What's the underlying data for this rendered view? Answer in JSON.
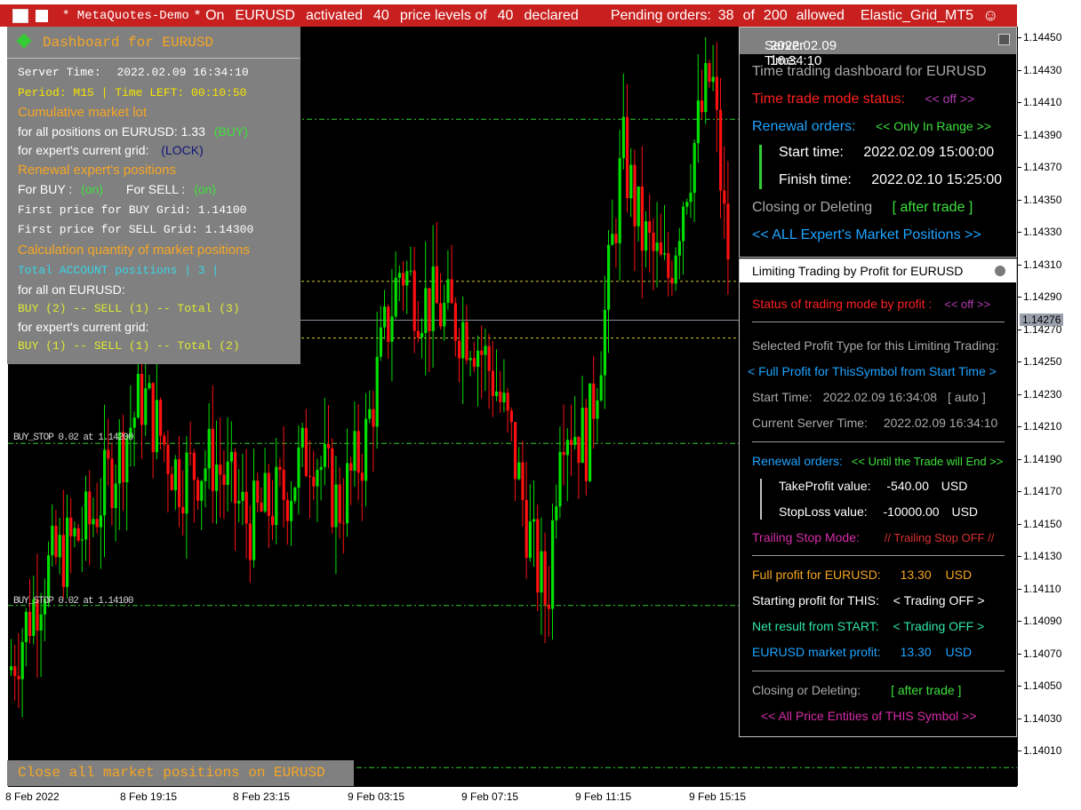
{
  "titlebar": {
    "server_label": "* MetaQuotes-Demo",
    "star": "*",
    "word_on": "On",
    "symbol": "EURUSD",
    "word_activated": "activated",
    "activated_count": "40",
    "word_price_levels_of": "price levels of",
    "declared_count": "40",
    "word_declared": "declared",
    "pending_label": "Pending orders:",
    "pending_count": "38",
    "word_of": "of",
    "pending_max": "200",
    "word_allowed": "allowed",
    "expert_name": "Elastic_Grid_MT5",
    "smiley": "☺"
  },
  "left_panel": {
    "title": "Dashboard for EURUSD",
    "server_time_label": "Server Time:",
    "server_time_value": "2022.02.09 16:34:10",
    "period_line": "Period: M15 | Time LEFT: 00:10:50",
    "cumulative_heading": "Cumulative market lot",
    "all_positions_label": "for all positions on EURUSD: 1.33",
    "all_positions_dir": "(BUY)",
    "current_grid_label": "for expert's current grid:",
    "current_grid_value": "(LOCK)",
    "renewal_heading": "Renewal expert's positions",
    "for_buy_label": "For BUY :",
    "for_buy_value": "(on)",
    "for_sell_label": "For SELL :",
    "for_sell_value": "(on)",
    "first_buy_line": "First price for BUY Grid:  1.14100",
    "first_sell_line": "First price for SELL Grid: 1.14300",
    "calc_heading": "Calculation quantity of market positions",
    "total_account_line": "Total ACCOUNT positions | 3 |",
    "for_all_on_label": "for all on EURUSD:",
    "for_all_on_counts": "BUY (2) -- SELL (1) -- Total (3)",
    "for_grid_label": "for expert's current grid:",
    "for_grid_counts": "BUY (1) -- SELL (1) -- Total (2)",
    "close_button": "Close all market positions on EURUSD"
  },
  "right_panel1": {
    "header_label": "Server Time:",
    "header_value": "2022.02.09 16:34:10",
    "dashboard_title": "Time trading dashboard for EURUSD",
    "mode_status_label": "Time trade mode status:",
    "mode_status_value": "<< off >>",
    "renewal_label": "Renewal orders:",
    "renewal_value": "<< Only In Range >>",
    "start_label": "Start  time:",
    "start_value": "2022.02.09 15:00:00",
    "finish_label": "Finish time:",
    "finish_value": "2022.02.10 15:25:00",
    "closing_label": "Closing or Deleting",
    "closing_value": "[ after trade ]",
    "all_positions_link": "<<   ALL Expert's Market Positions   >>"
  },
  "right_panel2": {
    "header_title": "Limiting Trading by Profit for  EURUSD",
    "status_label": "Status of trading mode by profit :",
    "status_value": "<< off >>",
    "profit_type_label": "Selected Profit Type for this Limiting Trading:",
    "profit_type_value": "< Full Profit for ThisSymbol from Start Time >",
    "start_time_label": "Start  Time:",
    "start_time_value": "2022.02.09 16:34:08",
    "start_time_mode": "[ auto ]",
    "current_time_label": "Current Server Time:",
    "current_time_value": "2022.02.09 16:34:10",
    "renewal_label": "Renewal orders:",
    "renewal_value": "<< Until the Trade will End >>",
    "tp_label": "TakeProfit  value:",
    "tp_value": "-540.00",
    "tp_unit": "USD",
    "sl_label": "StopLoss  value:",
    "sl_value": "-10000.00",
    "sl_unit": "USD",
    "trailing_label": "Trailing Stop Mode:",
    "trailing_value": "//   Trailing Stop OFF  //",
    "full_profit_label": "Full profit for  EURUSD:",
    "full_profit_value": "13.30",
    "full_profit_unit": "USD",
    "starting_label": "Starting  profit for  THIS:",
    "starting_value": "<  Trading OFF  >",
    "net_label": "Net result from  START:",
    "net_value": "<  Trading OFF  >",
    "market_label": "EURUSD  market profit:",
    "market_value": "13.30",
    "market_unit": "USD",
    "closing_label": "Closing  or  Deleting:",
    "closing_value": "[ after trade ]",
    "entities_link": "<<  All Price Entities of THIS Symbol  >>"
  },
  "chart_labels": {
    "level_label_1": "BUY_STOP 0.02 at 1.14200",
    "level_label_2": "BUY_STOP 0.02 at 1.14100"
  },
  "y_axis": {
    "ticks": [
      "1.14450",
      "1.14430",
      "1.14410",
      "1.14390",
      "1.14370",
      "1.14350",
      "1.14330",
      "1.14310",
      "1.14290",
      "1.14270",
      "1.14250",
      "1.14230",
      "1.14210",
      "1.14190",
      "1.14170",
      "1.14150",
      "1.14130",
      "1.14110",
      "1.14090",
      "1.14070",
      "1.14050",
      "1.14030",
      "1.14010"
    ],
    "current_price": "1.14276"
  },
  "x_axis": {
    "ticks": [
      "8 Feb 2022",
      "8 Feb 19:15",
      "8 Feb 23:15",
      "9 Feb 03:15",
      "9 Feb 07:15",
      "9 Feb 11:15",
      "9 Feb 15:15"
    ]
  },
  "colors": {
    "bull": "#00e000",
    "bear": "#ff1010",
    "title_bar": "#c8201f"
  }
}
